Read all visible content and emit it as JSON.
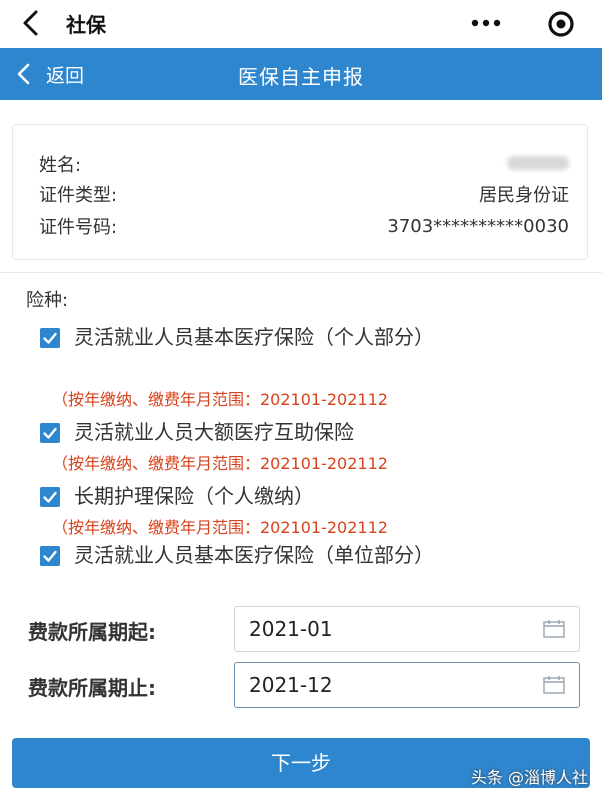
{
  "wechat_bar": {
    "title": "社保"
  },
  "header": {
    "back_label": "返回",
    "title": "医保自主申报",
    "bg_color": "#2e86cf"
  },
  "info": {
    "rows": [
      {
        "label": "姓名:",
        "value": ""
      },
      {
        "label": "证件类型:",
        "value": "居民身份证"
      },
      {
        "label": "证件号码:",
        "value": "3703**********0030"
      }
    ]
  },
  "insurance": {
    "label": "险种:",
    "items": [
      {
        "name": "灵活就业人员基本医疗保险（个人部分）",
        "checked": true,
        "note": "（按年缴纳、缴费年月范围：202101-202112"
      },
      {
        "name": "灵活就业人员大额医疗互助保险",
        "checked": true,
        "note": "（按年缴纳、缴费年月范围：202101-202112"
      },
      {
        "name": "长期护理保险（个人缴纳）",
        "checked": true,
        "note": "（按年缴纳、缴费年月范围：202101-202112"
      },
      {
        "name": "灵活就业人员基本医疗保险（单位部分）",
        "checked": true
      }
    ]
  },
  "period": {
    "start_label": "费款所属期起:",
    "start_value": "2021-01",
    "end_label": "费款所属期止:",
    "end_value": "2021-12"
  },
  "next_button": "下一步",
  "watermark": "头条 @淄博人社"
}
